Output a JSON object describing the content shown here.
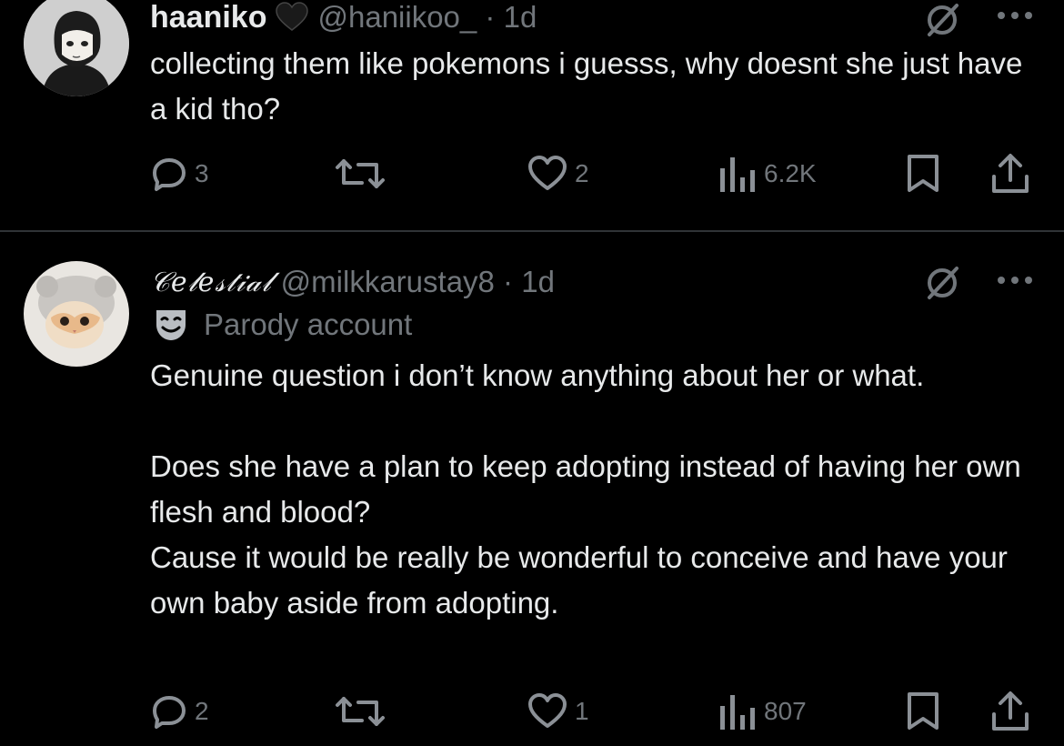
{
  "tweets": [
    {
      "author_name": "haaniko",
      "handle_time": "@haniikoo_ · 1d",
      "text": "collecting them like pokemons i guesss, why doesnt she just have a kid tho?",
      "replies": "3",
      "likes": "2",
      "views": "6.2K"
    },
    {
      "author_name": "𝒞𝑒𝓁𝑒𝓈𝓉𝒾𝒶𝓁",
      "handle_time": "@milkkarustay8 · 1d",
      "parody_label": "Parody account",
      "text": "Genuine question i don’t know anything about her or what.\n\nDoes she have a plan to keep adopting instead of having her own flesh and blood?\nCause it would be really be wonderful to conceive and have your own baby aside from adopting.",
      "replies": "2",
      "likes": "1",
      "views": "807"
    }
  ],
  "colors": {
    "background": "#000000",
    "text": "#e7e9ea",
    "secondary": "#71767b",
    "divider": "#2f3336"
  },
  "icons": [
    "reply-icon",
    "retweet-icon",
    "like-icon",
    "views-icon",
    "bookmark-icon",
    "share-icon",
    "mute-icon",
    "more-icon",
    "heart-badge-icon",
    "parody-mask-icon"
  ]
}
